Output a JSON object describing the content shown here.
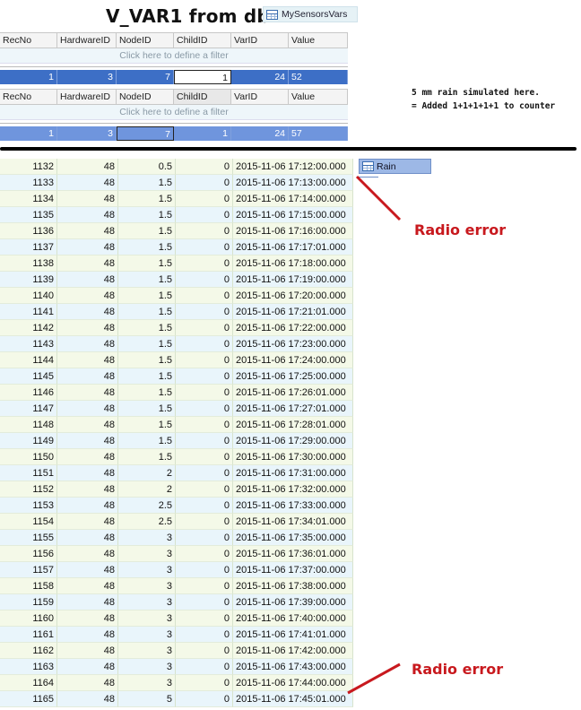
{
  "title": "V_VAR1 from db",
  "tab_label": "MySensorsVars",
  "columns": [
    "RecNo",
    "HardwareID",
    "NodeID",
    "ChildID",
    "VarID",
    "Value"
  ],
  "filter_hint": "Click here to define a filter",
  "query1_row": [
    "1",
    "3",
    "7",
    "1",
    "24",
    "52"
  ],
  "query2_row": [
    "1",
    "3",
    "7",
    "1",
    "24",
    "57"
  ],
  "note": {
    "line1": "5 mm rain simulated here.",
    "line2": "= Added 1+1+1+1+1 to counter"
  },
  "table_name": "Rain",
  "annotations": [
    "Radio error",
    "Radio error"
  ],
  "rows": [
    [
      "1132",
      "48",
      "0.5",
      "0",
      "2015-11-06 17:12:00.000"
    ],
    [
      "1133",
      "48",
      "1.5",
      "0",
      "2015-11-06 17:13:00.000"
    ],
    [
      "1134",
      "48",
      "1.5",
      "0",
      "2015-11-06 17:14:00.000"
    ],
    [
      "1135",
      "48",
      "1.5",
      "0",
      "2015-11-06 17:15:00.000"
    ],
    [
      "1136",
      "48",
      "1.5",
      "0",
      "2015-11-06 17:16:00.000"
    ],
    [
      "1137",
      "48",
      "1.5",
      "0",
      "2015-11-06 17:17:01.000"
    ],
    [
      "1138",
      "48",
      "1.5",
      "0",
      "2015-11-06 17:18:00.000"
    ],
    [
      "1139",
      "48",
      "1.5",
      "0",
      "2015-11-06 17:19:00.000"
    ],
    [
      "1140",
      "48",
      "1.5",
      "0",
      "2015-11-06 17:20:00.000"
    ],
    [
      "1141",
      "48",
      "1.5",
      "0",
      "2015-11-06 17:21:01.000"
    ],
    [
      "1142",
      "48",
      "1.5",
      "0",
      "2015-11-06 17:22:00.000"
    ],
    [
      "1143",
      "48",
      "1.5",
      "0",
      "2015-11-06 17:23:00.000"
    ],
    [
      "1144",
      "48",
      "1.5",
      "0",
      "2015-11-06 17:24:00.000"
    ],
    [
      "1145",
      "48",
      "1.5",
      "0",
      "2015-11-06 17:25:00.000"
    ],
    [
      "1146",
      "48",
      "1.5",
      "0",
      "2015-11-06 17:26:01.000"
    ],
    [
      "1147",
      "48",
      "1.5",
      "0",
      "2015-11-06 17:27:01.000"
    ],
    [
      "1148",
      "48",
      "1.5",
      "0",
      "2015-11-06 17:28:01.000"
    ],
    [
      "1149",
      "48",
      "1.5",
      "0",
      "2015-11-06 17:29:00.000"
    ],
    [
      "1150",
      "48",
      "1.5",
      "0",
      "2015-11-06 17:30:00.000"
    ],
    [
      "1151",
      "48",
      "2",
      "0",
      "2015-11-06 17:31:00.000"
    ],
    [
      "1152",
      "48",
      "2",
      "0",
      "2015-11-06 17:32:00.000"
    ],
    [
      "1153",
      "48",
      "2.5",
      "0",
      "2015-11-06 17:33:00.000"
    ],
    [
      "1154",
      "48",
      "2.5",
      "0",
      "2015-11-06 17:34:01.000"
    ],
    [
      "1155",
      "48",
      "3",
      "0",
      "2015-11-06 17:35:00.000"
    ],
    [
      "1156",
      "48",
      "3",
      "0",
      "2015-11-06 17:36:01.000"
    ],
    [
      "1157",
      "48",
      "3",
      "0",
      "2015-11-06 17:37:00.000"
    ],
    [
      "1158",
      "48",
      "3",
      "0",
      "2015-11-06 17:38:00.000"
    ],
    [
      "1159",
      "48",
      "3",
      "0",
      "2015-11-06 17:39:00.000"
    ],
    [
      "1160",
      "48",
      "3",
      "0",
      "2015-11-06 17:40:00.000"
    ],
    [
      "1161",
      "48",
      "3",
      "0",
      "2015-11-06 17:41:01.000"
    ],
    [
      "1162",
      "48",
      "3",
      "0",
      "2015-11-06 17:42:00.000"
    ],
    [
      "1163",
      "48",
      "3",
      "0",
      "2015-11-06 17:43:00.000"
    ],
    [
      "1164",
      "48",
      "3",
      "0",
      "2015-11-06 17:44:00.000"
    ],
    [
      "1165",
      "48",
      "5",
      "0",
      "2015-11-06 17:45:01.000"
    ]
  ],
  "colors": {
    "selection": "#3d6fc6",
    "annotation": "#c8191e"
  },
  "icons": [
    "table-icon"
  ]
}
